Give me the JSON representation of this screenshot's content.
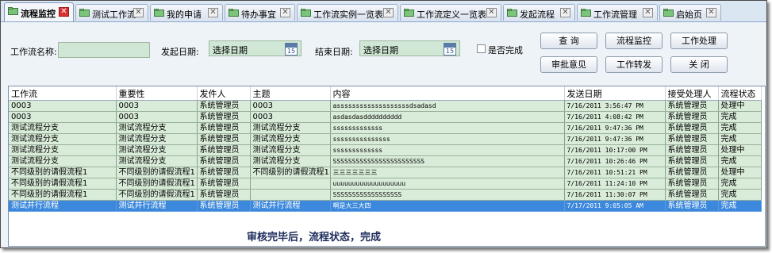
{
  "tabs": [
    {
      "label": "流程监控",
      "active": true
    },
    {
      "label": "测试工作流",
      "active": false
    },
    {
      "label": "我的申请",
      "active": false
    },
    {
      "label": "待办事宜",
      "active": false
    },
    {
      "label": "工作流实例一览表",
      "active": false
    },
    {
      "label": "工作流定义一览表",
      "active": false
    },
    {
      "label": "发起流程",
      "active": false
    },
    {
      "label": "工作流管理",
      "active": false
    },
    {
      "label": "启始页",
      "active": false
    }
  ],
  "query": {
    "workflow_name_label": "工作流名称:",
    "workflow_name_value": "",
    "start_date_label": "发起日期:",
    "start_date_placeholder": "选择日期",
    "end_date_label": "结束日期:",
    "end_date_placeholder": "选择日期",
    "calendar_day": "15",
    "completed_label": "是否完成",
    "completed_checked": false
  },
  "buttons": {
    "query": "查  询",
    "monitor": "流程监控",
    "handle": "工作处理",
    "approval": "审批意见",
    "forward": "工作转发",
    "close": "关  闭"
  },
  "table": {
    "columns": [
      "工作流",
      "重要性",
      "发件人",
      "主题",
      "内容",
      "发送日期",
      "接受处理人",
      "流程状态"
    ],
    "rows": [
      [
        "0003",
        "0003",
        "系统管理员",
        "0003",
        "asssssssssssssssssssdsadasd",
        "7/16/2011 3:56:47 PM",
        "系统管理员",
        "处理中"
      ],
      [
        "0003",
        "0003",
        "系统管理员",
        "0003",
        "asdasdasdddddddddd",
        "7/16/2011 4:08:42 PM",
        "系统管理员",
        "完成"
      ],
      [
        "测试流程分支",
        "测试流程分支",
        "系统管理员",
        "测试流程分支",
        "sssssssssssss",
        "7/16/2011 9:47:36 PM",
        "系统管理员",
        "完成"
      ],
      [
        "测试流程分支",
        "测试流程分支",
        "系统管理员",
        "测试流程分支",
        "sssssssssssssss",
        "7/16/2011 9:47:36 PM",
        "系统管理员",
        "完成"
      ],
      [
        "测试流程分支",
        "测试流程分支",
        "系统管理员",
        "测试流程分支",
        "sssssssssssss",
        "7/16/2011 10:17:00 PM",
        "系统管理员",
        "处理中"
      ],
      [
        "测试流程分支",
        "测试流程分支",
        "系统管理员",
        "测试流程分支",
        "SSSSSSSSSSSSSSSSSSSSSSSS",
        "7/16/2011 10:26:46 PM",
        "系统管理员",
        "完成"
      ],
      [
        "不同级别的请假流程1",
        "不同级别的请假流程1",
        "系统管理员",
        "不同级别的请假流程1",
        "三三三三三三三",
        "7/16/2011 10:51:21 PM",
        "系统管理员",
        "处理中"
      ],
      [
        "不同级别的请假流程1",
        "不同级别的请假流程1",
        "系统管理员",
        "",
        "uuuuuuuuuuuuuuuuuuu",
        "7/16/2011 11:24:10 PM",
        "系统管理员",
        "完成"
      ],
      [
        "不同级别的请假流程1",
        "不同级别的请假流程1",
        "系统管理员",
        "",
        "SSSSSSSSSSSSSSSSSS",
        "7/16/2011 11:30:07 PM",
        "系统管理员",
        "完成"
      ],
      [
        "测试并行流程",
        "测试并行流程",
        "系统管理员",
        "测试并行流程",
        "啊是大三大四",
        "7/17/2011 9:05:05 AM",
        "系统管理员",
        "完成"
      ]
    ],
    "selected_row": 9
  },
  "caption": "审核完毕后，流程状态，完成",
  "colors": {
    "row_bg": "#d9ecd9",
    "selected_bg": "#3c88dc",
    "tab_strip": "#dbe6f3",
    "active_close": "#d83030"
  }
}
